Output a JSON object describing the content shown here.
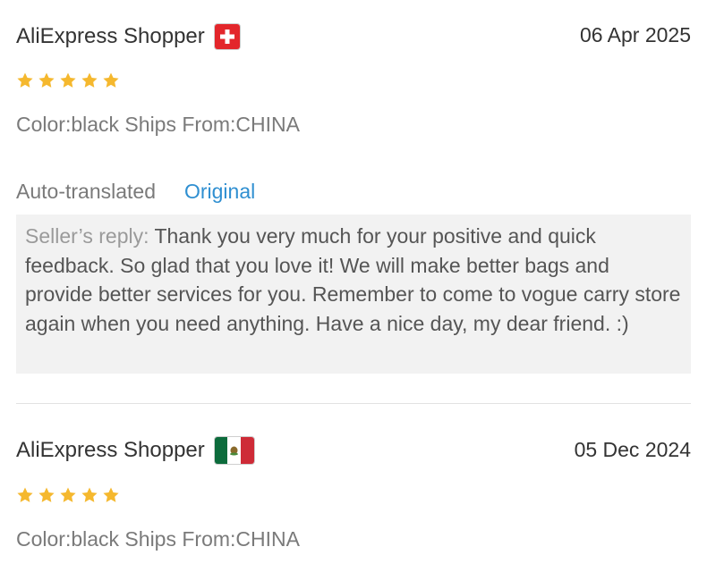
{
  "reviews": [
    {
      "author": "AliExpress Shopper",
      "country": "Switzerland",
      "flag_icon": "swiss-flag-icon",
      "date": "06 Apr 2025",
      "rating": 5,
      "sku": "Color:black Ships From:CHINA",
      "auto_translated": "Auto-translated",
      "original_link": "Original",
      "reply_label": "Seller’s reply:",
      "reply_text": " Thank you very much for your positive and quick feedback. So glad that you love it! We will make better bags and provide better services for you. Remember to come to vogue carry store again when you need anything. Have a nice day, my dear friend. :)"
    },
    {
      "author": "AliExpress Shopper",
      "country": "Mexico",
      "flag_icon": "mexico-flag-icon",
      "date": "05 Dec 2024",
      "rating": 5,
      "sku": "Color:black Ships From:CHINA"
    }
  ],
  "colors": {
    "star": "#f5b82e",
    "link": "#2f8fd1",
    "reply_bg": "#f2f2f2",
    "muted_text": "#7a7a7a"
  }
}
